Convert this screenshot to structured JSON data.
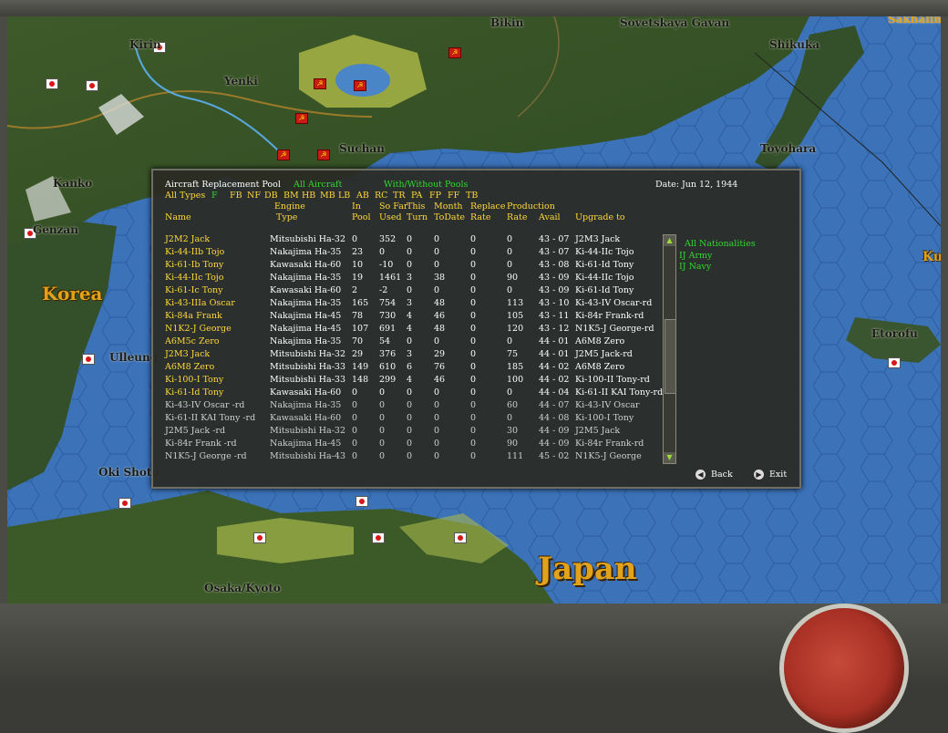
{
  "map": {
    "labels": {
      "bikin": "Bikin",
      "sovetskaya_gavan": "Sovetskaya Gavan",
      "kirin": "Kirin",
      "yenki": "Yenki",
      "shikuka": "Shikuka",
      "suchan": "Suchan",
      "toyohara": "Toyohara",
      "kanko": "Kanko",
      "genzan": "Genzan",
      "korea": "Korea",
      "ulleung": "Ulleung",
      "etorofu": "Etorofu",
      "oki_shoto": "Oki Shoto",
      "osaka_kyoto": "Osaka/Kyoto",
      "japan": "Japan",
      "sakhalin": "Sakhalin",
      "ku": "Ku"
    }
  },
  "dialog": {
    "title": "Aircraft Replacement Pool",
    "filter_aircraft": "All Aircraft",
    "filter_pools": "With/Without Pools",
    "date": "Date: Jun 12, 1944",
    "type_filters": [
      "All Types",
      "F",
      "FB",
      "NF",
      "DB",
      "BM",
      "HB",
      "MB",
      "LB",
      "AB",
      "RC",
      "TR",
      "PA",
      "FP",
      "FF",
      "TB"
    ],
    "headers": {
      "name": "Name",
      "engine_top": "Engine",
      "engine_bottom": "Type",
      "in_top": "In",
      "in_bottom": "Pool",
      "sofar_top": "So Far",
      "sofar_bottom": "Used",
      "this_top": "This",
      "this_bottom": "Turn",
      "month_top": "Month",
      "month_bottom": "ToDate",
      "replace_top": "Replace",
      "replace_bottom": "Rate",
      "prod_top": "Production",
      "prod_rate": "Rate",
      "prod_avail": "Avail",
      "upgrade": "Upgrade to"
    },
    "nationalities": [
      "All Nationalities",
      "IJ Army",
      "IJ Navy"
    ],
    "back_label": "Back",
    "exit_label": "Exit",
    "rows": [
      {
        "name": "J2M2 Jack",
        "engine": "Mitsubishi Ha-32",
        "pool": "0",
        "used": "352",
        "turn": "0",
        "month": "0",
        "replace": "0",
        "rate": "0",
        "avail": "43 - 07",
        "upgrade": "J2M3 Jack",
        "color": "yellow"
      },
      {
        "name": "Ki-44-IIb Tojo",
        "engine": "Nakajima Ha-35",
        "pool": "23",
        "used": "0",
        "turn": "0",
        "month": "0",
        "replace": "0",
        "rate": "0",
        "avail": "43 - 07",
        "upgrade": "Ki-44-IIc Tojo",
        "color": "yellow"
      },
      {
        "name": "Ki-61-Ib Tony",
        "engine": "Kawasaki Ha-60",
        "pool": "10",
        "used": "-10",
        "turn": "0",
        "month": "0",
        "replace": "0",
        "rate": "0",
        "avail": "43 - 08",
        "upgrade": "Ki-61-Id Tony",
        "color": "yellow"
      },
      {
        "name": "Ki-44-IIc Tojo",
        "engine": "Nakajima Ha-35",
        "pool": "19",
        "used": "1461",
        "turn": "3",
        "month": "38",
        "replace": "0",
        "rate": "90",
        "avail": "43 - 09",
        "upgrade": "Ki-44-IIc Tojo",
        "color": "yellow"
      },
      {
        "name": "Ki-61-Ic Tony",
        "engine": "Kawasaki Ha-60",
        "pool": "2",
        "used": "-2",
        "turn": "0",
        "month": "0",
        "replace": "0",
        "rate": "0",
        "avail": "43 - 09",
        "upgrade": "Ki-61-Id Tony",
        "color": "yellow"
      },
      {
        "name": "Ki-43-IIIa Oscar",
        "engine": "Nakajima Ha-35",
        "pool": "165",
        "used": "754",
        "turn": "3",
        "month": "48",
        "replace": "0",
        "rate": "113",
        "avail": "43 - 10",
        "upgrade": "Ki-43-IV Oscar-rd",
        "color": "yellow"
      },
      {
        "name": "Ki-84a Frank",
        "engine": "Nakajima Ha-45",
        "pool": "78",
        "used": "730",
        "turn": "4",
        "month": "46",
        "replace": "0",
        "rate": "105",
        "avail": "43 - 11",
        "upgrade": "Ki-84r Frank-rd",
        "color": "yellow"
      },
      {
        "name": "N1K2-J George",
        "engine": "Nakajima Ha-45",
        "pool": "107",
        "used": "691",
        "turn": "4",
        "month": "48",
        "replace": "0",
        "rate": "120",
        "avail": "43 - 12",
        "upgrade": "N1K5-J George-rd",
        "color": "yellow"
      },
      {
        "name": "A6M5c Zero",
        "engine": "Nakajima Ha-35",
        "pool": "70",
        "used": "54",
        "turn": "0",
        "month": "0",
        "replace": "0",
        "rate": "0",
        "avail": "44 - 01",
        "upgrade": "A6M8 Zero",
        "color": "yellow"
      },
      {
        "name": "J2M3 Jack",
        "engine": "Mitsubishi Ha-32",
        "pool": "29",
        "used": "376",
        "turn": "3",
        "month": "29",
        "replace": "0",
        "rate": "75",
        "avail": "44 - 01",
        "upgrade": "J2M5 Jack-rd",
        "color": "yellow"
      },
      {
        "name": "A6M8 Zero",
        "engine": "Mitsubishi Ha-33",
        "pool": "149",
        "used": "610",
        "turn": "6",
        "month": "76",
        "replace": "0",
        "rate": "185",
        "avail": "44 - 02",
        "upgrade": "A6M8 Zero",
        "color": "yellow"
      },
      {
        "name": "Ki-100-I Tony",
        "engine": "Mitsubishi Ha-33",
        "pool": "148",
        "used": "299",
        "turn": "4",
        "month": "46",
        "replace": "0",
        "rate": "100",
        "avail": "44 - 02",
        "upgrade": "Ki-100-II Tony-rd",
        "color": "yellow"
      },
      {
        "name": "Ki-61-Id Tony",
        "engine": "Kawasaki Ha-60",
        "pool": "0",
        "used": "0",
        "turn": "0",
        "month": "0",
        "replace": "0",
        "rate": "0",
        "avail": "44 - 04",
        "upgrade": "Ki-61-II KAI Tony-rd",
        "color": "yellow"
      },
      {
        "name": "Ki-43-IV Oscar -rd",
        "engine": "Nakajima Ha-35",
        "pool": "0",
        "used": "0",
        "turn": "0",
        "month": "0",
        "replace": "0",
        "rate": "60",
        "avail": "44 - 07",
        "upgrade": "Ki-43-IV Oscar",
        "color": "gray"
      },
      {
        "name": "Ki-61-II KAI Tony -rd",
        "engine": "Kawasaki Ha-60",
        "pool": "0",
        "used": "0",
        "turn": "0",
        "month": "0",
        "replace": "0",
        "rate": "0",
        "avail": "44 - 08",
        "upgrade": "Ki-100-I Tony",
        "color": "gray"
      },
      {
        "name": "J2M5 Jack -rd",
        "engine": "Mitsubishi Ha-32",
        "pool": "0",
        "used": "0",
        "turn": "0",
        "month": "0",
        "replace": "0",
        "rate": "30",
        "avail": "44 - 09",
        "upgrade": "J2M5 Jack",
        "color": "gray"
      },
      {
        "name": "Ki-84r Frank -rd",
        "engine": "Nakajima Ha-45",
        "pool": "0",
        "used": "0",
        "turn": "0",
        "month": "0",
        "replace": "0",
        "rate": "90",
        "avail": "44 - 09",
        "upgrade": "Ki-84r Frank-rd",
        "color": "gray"
      },
      {
        "name": "N1K5-J George -rd",
        "engine": "Mitsubishi Ha-43",
        "pool": "0",
        "used": "0",
        "turn": "0",
        "month": "0",
        "replace": "0",
        "rate": "111",
        "avail": "45 - 02",
        "upgrade": "N1K5-J George",
        "color": "gray"
      }
    ]
  }
}
